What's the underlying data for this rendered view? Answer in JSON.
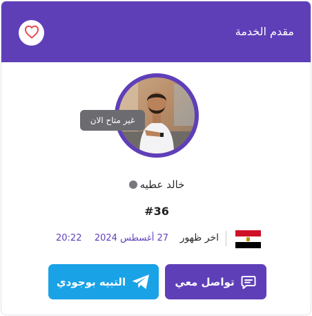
{
  "header": {
    "title": "مقدم الخدمة"
  },
  "provider": {
    "name": "خالد عطيه",
    "status_text": "غير متاح الان",
    "rank": "#36"
  },
  "last_seen": {
    "label": "اخر ظهور",
    "date": "27 أغسطس 2024",
    "time": "20:22"
  },
  "actions": {
    "contact_label": "تواصل معي",
    "notify_label": "التبيه بوجودي"
  },
  "icons": {
    "favorite": "heart-icon",
    "flag": "egypt-flag-icon",
    "contact": "chat-icon",
    "notify": "telegram-icon"
  },
  "colors": {
    "brand": "#5f3fb8",
    "notify": "#1aa2e6",
    "heart": "#e5484d",
    "status_dot": "#77787d"
  }
}
